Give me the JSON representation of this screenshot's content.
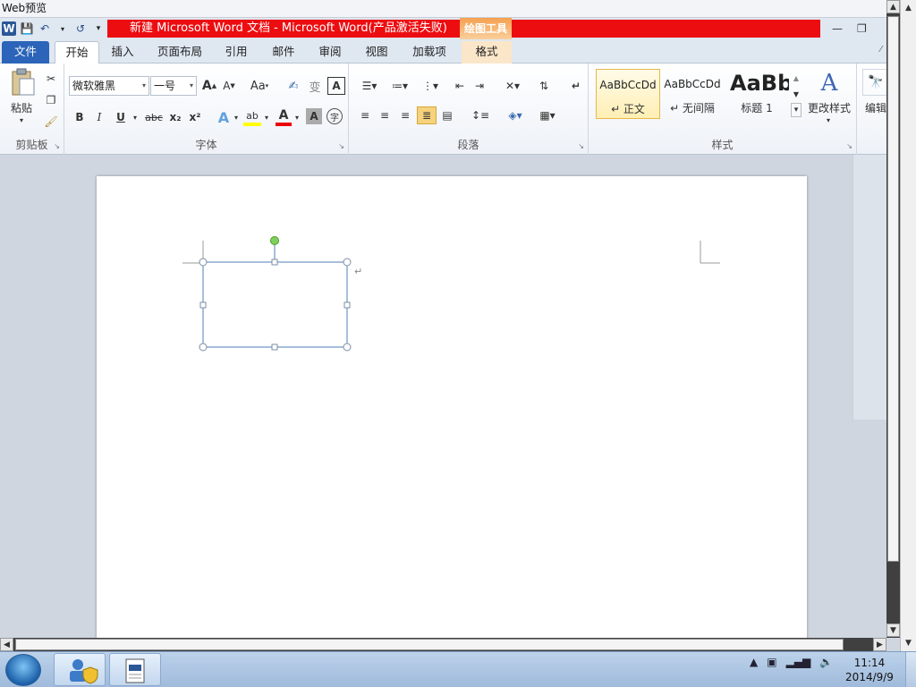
{
  "window": {
    "preview_title": "Web预览",
    "doc_title": "新建 Microsoft Word 文档 - Microsoft Word(产品激活失败)",
    "tool_tab": "绘图工具"
  },
  "qat": {
    "word_glyph": "W",
    "save_glyph": "💾",
    "undo_glyph": "↶",
    "redo_glyph": "↺",
    "more_glyph": "▾"
  },
  "tabs": {
    "file": "文件",
    "home": "开始",
    "insert": "插入",
    "layout": "页面布局",
    "references": "引用",
    "mailings": "邮件",
    "review": "审阅",
    "view": "视图",
    "addins": "加载项",
    "format": "格式"
  },
  "clipboard": {
    "paste": "粘贴",
    "group": "剪贴板"
  },
  "font": {
    "name": "微软雅黑",
    "size": "一号",
    "grow": "A",
    "shrink": "A",
    "case": "Aa",
    "bold": "B",
    "italic": "I",
    "underline": "U",
    "strike": "abc",
    "subscript": "x₂",
    "superscript": "x²",
    "group": "字体"
  },
  "paragraph": {
    "group": "段落"
  },
  "styles": {
    "items": [
      {
        "sample": "AaBbCcDd",
        "name": "↵ 正文"
      },
      {
        "sample": "AaBbCcDd",
        "name": "↵ 无间隔"
      },
      {
        "sample": "AaBb",
        "name": "标题 1"
      }
    ],
    "change": "更改样式",
    "group": "样式"
  },
  "editing": {
    "label": "编辑"
  },
  "taskbar": {
    "time": "11:14",
    "date": "2014/9/9"
  },
  "colors": {
    "title_red": "#ec0d11",
    "file_tab": "#2b64b8",
    "shape_stroke": "#4f7fb5",
    "rotate_handle": "#7fd05a"
  }
}
